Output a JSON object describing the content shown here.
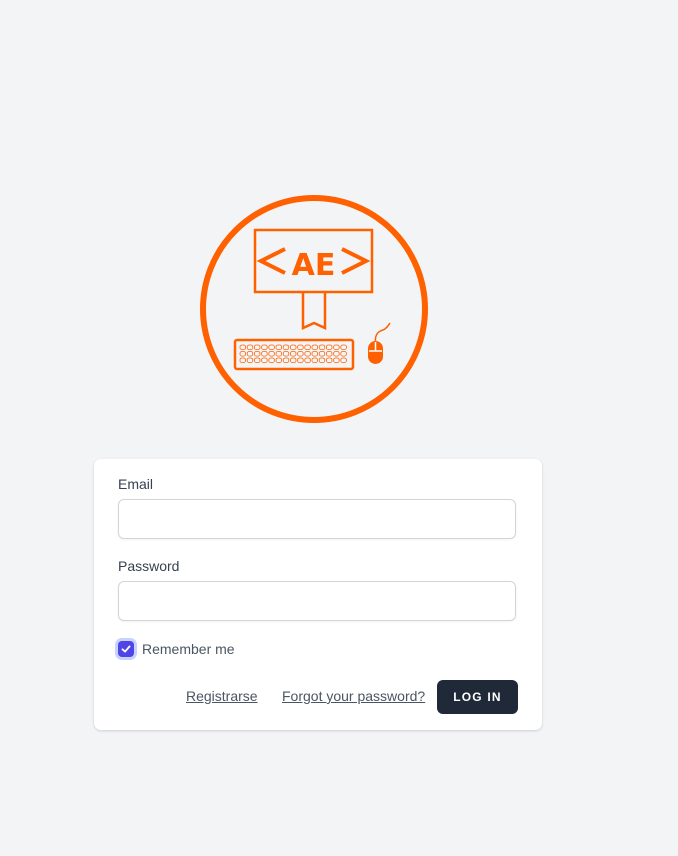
{
  "brand": {
    "logo_text": "AE",
    "accent_color": "#ff6000"
  },
  "form": {
    "email_label": "Email",
    "email_value": "",
    "password_label": "Password",
    "password_value": "",
    "remember_label": "Remember me",
    "remember_checked": true,
    "register_link": "Registrarse",
    "forgot_link": "Forgot your password?",
    "login_button": "LOG IN"
  },
  "icons": {
    "checkbox": "check-icon",
    "logo": "computer-keyboard-mouse-logo"
  }
}
